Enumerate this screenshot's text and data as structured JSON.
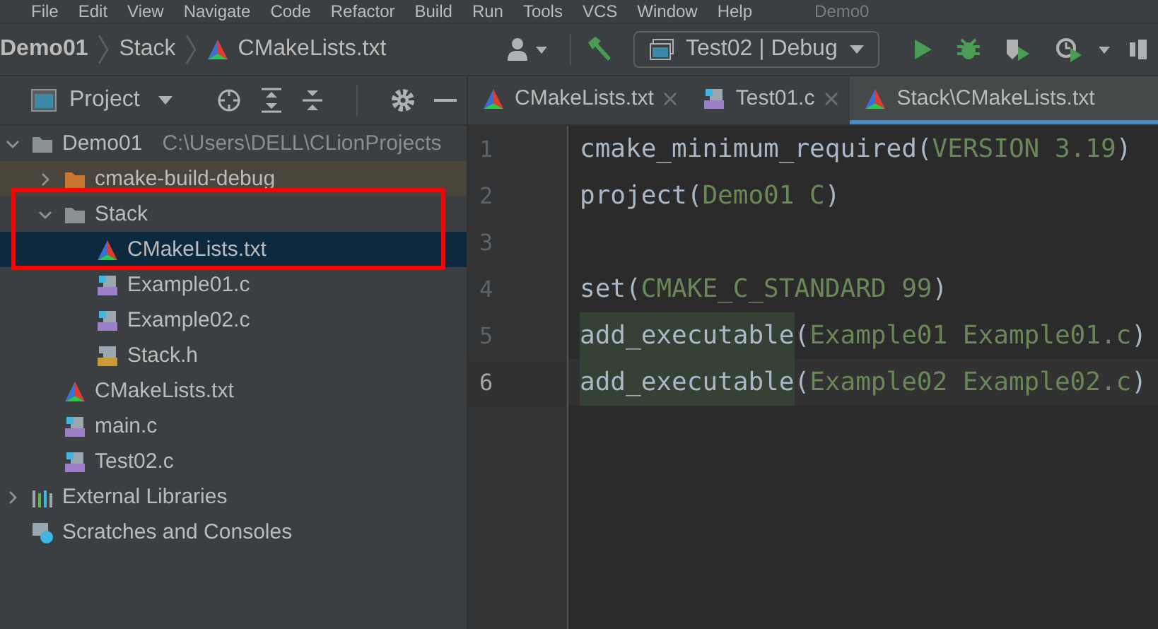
{
  "menu_bar": {
    "items": [
      "File",
      "Edit",
      "View",
      "Navigate",
      "Code",
      "Refactor",
      "Build",
      "Run",
      "Tools",
      "VCS",
      "Window",
      "Help"
    ],
    "window_title": "Demo0"
  },
  "breadcrumbs": [
    {
      "label": "Demo01",
      "kind": "project"
    },
    {
      "label": "Stack",
      "kind": "folder"
    },
    {
      "label": "CMakeLists.txt",
      "kind": "cmake"
    }
  ],
  "run_configuration": {
    "label": "Test02 | Debug"
  },
  "project_panel": {
    "title": "Project",
    "tree": [
      {
        "label": "Demo01",
        "path": "C:\\Users\\DELL\\CLionProjects",
        "kind": "folder",
        "expanded": true,
        "selected": false,
        "children": [
          {
            "label": "cmake-build-debug",
            "kind": "build-folder",
            "expanded": false,
            "selected": false
          },
          {
            "label": "Stack",
            "kind": "folder",
            "expanded": true,
            "selected": false,
            "children": [
              {
                "label": "CMakeLists.txt",
                "kind": "cmake",
                "selected": true
              },
              {
                "label": "Example01.c",
                "kind": "c",
                "selected": false
              },
              {
                "label": "Example02.c",
                "kind": "c",
                "selected": false
              },
              {
                "label": "Stack.h",
                "kind": "header",
                "selected": false
              }
            ]
          },
          {
            "label": "CMakeLists.txt",
            "kind": "cmake",
            "selected": false
          },
          {
            "label": "main.c",
            "kind": "c",
            "selected": false
          },
          {
            "label": "Test02.c",
            "kind": "c",
            "selected": false
          }
        ]
      },
      {
        "label": "External Libraries",
        "kind": "libraries",
        "expanded": false,
        "selected": false
      },
      {
        "label": "Scratches and Consoles",
        "kind": "scratches",
        "selected": false
      }
    ]
  },
  "editor_tabs": [
    {
      "label": "CMakeLists.txt",
      "kind": "cmake",
      "selected": false
    },
    {
      "label": "Test01.c",
      "kind": "c",
      "selected": false
    },
    {
      "label": "Stack\\CMakeLists.txt",
      "kind": "cmake",
      "selected": true
    }
  ],
  "editor": {
    "lines": [
      {
        "number": "1",
        "current": false,
        "segments": [
          {
            "text": "cmake_minimum_required",
            "kind": "command"
          },
          {
            "text": "(",
            "kind": "paren"
          },
          {
            "text": "VERSION 3.19",
            "kind": "argument"
          },
          {
            "text": ")",
            "kind": "paren"
          }
        ]
      },
      {
        "number": "2",
        "current": false,
        "segments": [
          {
            "text": "project",
            "kind": "command"
          },
          {
            "text": "(",
            "kind": "paren"
          },
          {
            "text": "Demo01 C",
            "kind": "argument"
          },
          {
            "text": ")",
            "kind": "paren"
          }
        ]
      },
      {
        "number": "3",
        "current": false
      },
      {
        "number": "4",
        "current": false,
        "segments": [
          {
            "text": "set",
            "kind": "command"
          },
          {
            "text": "(",
            "kind": "paren"
          },
          {
            "text": "CMAKE_C_STANDARD 99",
            "kind": "argument"
          },
          {
            "text": ")",
            "kind": "paren"
          }
        ]
      },
      {
        "number": "5",
        "current": false,
        "segments": [
          {
            "text": "add_executable",
            "kind": "highlighted-command"
          },
          {
            "text": "(",
            "kind": "paren"
          },
          {
            "text": "Example01 Example01.c",
            "kind": "argument"
          },
          {
            "text": ")",
            "kind": "paren"
          }
        ]
      },
      {
        "number": "6",
        "current": true,
        "segments": [
          {
            "text": "add_executable",
            "kind": "highlighted-command"
          },
          {
            "text": "(",
            "kind": "paren"
          },
          {
            "text": "Example02 Example02.c",
            "kind": "argument"
          },
          {
            "text": ")",
            "kind": "paren"
          }
        ]
      }
    ]
  }
}
